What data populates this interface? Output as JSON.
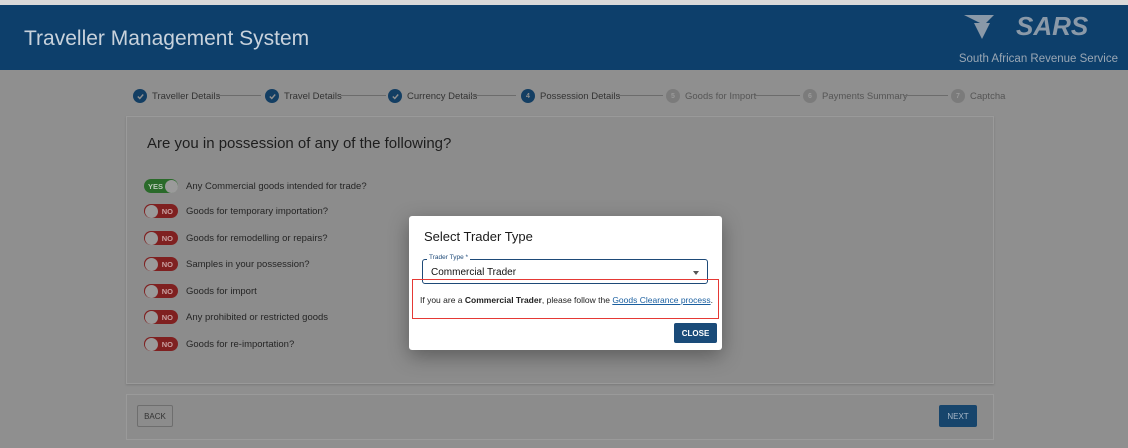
{
  "header": {
    "title": "Traveller Management System",
    "logo_text": "SARS",
    "tagline": "South African Revenue Service"
  },
  "stepper": {
    "steps": [
      {
        "label": "Traveller Details",
        "state": "done",
        "num": ""
      },
      {
        "label": "Travel Details",
        "state": "done",
        "num": ""
      },
      {
        "label": "Currency Details",
        "state": "done",
        "num": ""
      },
      {
        "label": "Possession Details",
        "state": "active",
        "num": "4"
      },
      {
        "label": "Goods for Import",
        "state": "pending",
        "num": "5"
      },
      {
        "label": "Payments Summary",
        "state": "pending",
        "num": "6"
      },
      {
        "label": "Captcha",
        "state": "pending",
        "num": "7"
      }
    ]
  },
  "form": {
    "question": "Are you in possession of any of the following?",
    "items": [
      {
        "label": "Any Commercial goods intended for trade?",
        "toggle": "YES",
        "on": true
      },
      {
        "label": "Goods for temporary importation?",
        "toggle": "NO",
        "on": false
      },
      {
        "label": "Goods for remodelling or repairs?",
        "toggle": "NO",
        "on": false
      },
      {
        "label": "Samples in your possession?",
        "toggle": "NO",
        "on": false
      },
      {
        "label": "Goods for import",
        "toggle": "NO",
        "on": false
      },
      {
        "label": "Any prohibited or restricted goods",
        "toggle": "NO",
        "on": false
      },
      {
        "label": "Goods for re-importation?",
        "toggle": "NO",
        "on": false
      }
    ]
  },
  "nav": {
    "back_label": "BACK",
    "next_label": "NEXT"
  },
  "modal": {
    "title": "Select Trader Type",
    "field_label": "Trader Type *",
    "field_value": "Commercial Trader",
    "info_prefix": "If you are a ",
    "info_bold": "Commercial Trader",
    "info_middle": ", please follow the ",
    "info_link": "Goods Clearance process",
    "info_suffix": ".",
    "close_label": "CLOSE"
  },
  "colors": {
    "header_bg": "#0d3f6b",
    "accent": "#1a4b79",
    "highlight_box": "#e53935",
    "toggle_yes": "#2a6a2a",
    "toggle_no": "#7f2020"
  }
}
